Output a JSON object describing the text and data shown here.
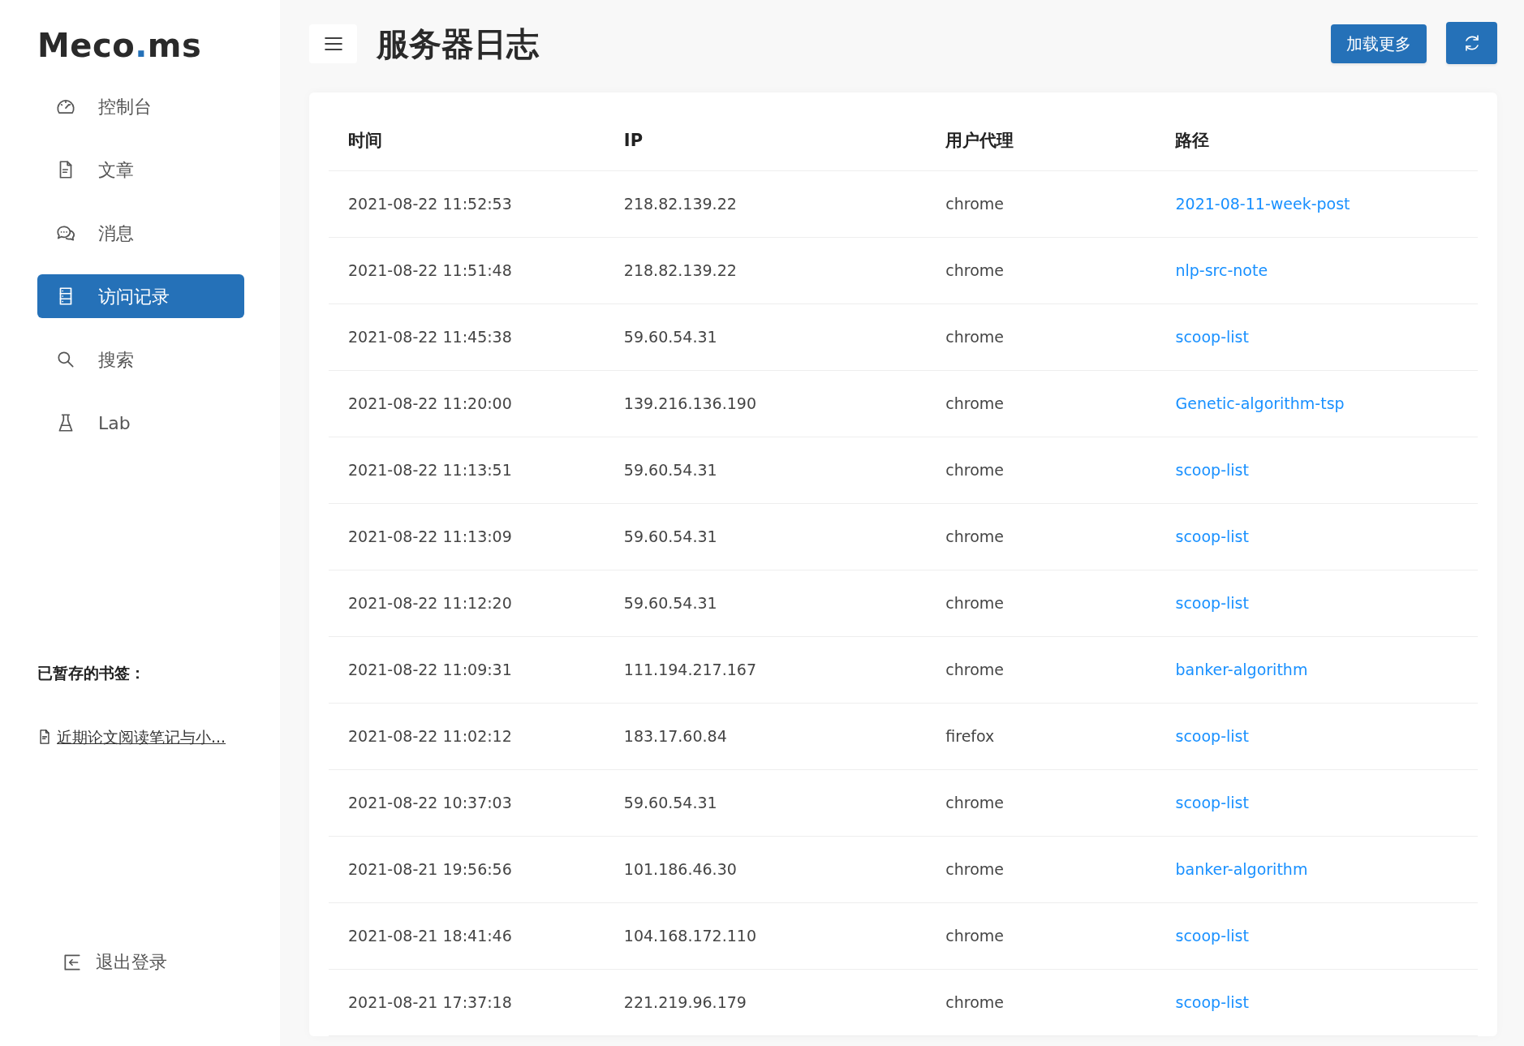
{
  "sidebar": {
    "logo": {
      "name": "Meco",
      "accent": ".",
      "suffix": "ms"
    },
    "items": [
      {
        "label": "控制台",
        "selected": false
      },
      {
        "label": "文章",
        "selected": false
      },
      {
        "label": "消息",
        "selected": false
      },
      {
        "label": "访问记录",
        "selected": true
      },
      {
        "label": "搜索",
        "selected": false
      },
      {
        "label": "Lab",
        "selected": false
      }
    ],
    "bookmarks": {
      "title": "已暂存的书签：",
      "items": [
        {
          "label": "近期论文阅读笔记与小..."
        }
      ]
    },
    "logout": {
      "label": "退出登录"
    }
  },
  "header": {
    "title": "服务器日志",
    "load_more": "加载更多"
  },
  "table": {
    "columns": [
      "时间",
      "IP",
      "用户代理",
      "路径"
    ],
    "rows": [
      {
        "time": "2021-08-22 11:52:53",
        "ip": "218.82.139.22",
        "agent": "chrome",
        "path": "2021-08-11-week-post"
      },
      {
        "time": "2021-08-22 11:51:48",
        "ip": "218.82.139.22",
        "agent": "chrome",
        "path": "nlp-src-note"
      },
      {
        "time": "2021-08-22 11:45:38",
        "ip": "59.60.54.31",
        "agent": "chrome",
        "path": "scoop-list"
      },
      {
        "time": "2021-08-22 11:20:00",
        "ip": "139.216.136.190",
        "agent": "chrome",
        "path": "Genetic-algorithm-tsp"
      },
      {
        "time": "2021-08-22 11:13:51",
        "ip": "59.60.54.31",
        "agent": "chrome",
        "path": "scoop-list"
      },
      {
        "time": "2021-08-22 11:13:09",
        "ip": "59.60.54.31",
        "agent": "chrome",
        "path": "scoop-list"
      },
      {
        "time": "2021-08-22 11:12:20",
        "ip": "59.60.54.31",
        "agent": "chrome",
        "path": "scoop-list"
      },
      {
        "time": "2021-08-22 11:09:31",
        "ip": "111.194.217.167",
        "agent": "chrome",
        "path": "banker-algorithm"
      },
      {
        "time": "2021-08-22 11:02:12",
        "ip": "183.17.60.84",
        "agent": "firefox",
        "path": "scoop-list"
      },
      {
        "time": "2021-08-22 10:37:03",
        "ip": "59.60.54.31",
        "agent": "chrome",
        "path": "scoop-list"
      },
      {
        "time": "2021-08-21 19:56:56",
        "ip": "101.186.46.30",
        "agent": "chrome",
        "path": "banker-algorithm"
      },
      {
        "time": "2021-08-21 18:41:46",
        "ip": "104.168.172.110",
        "agent": "chrome",
        "path": "scoop-list"
      },
      {
        "time": "2021-08-21 17:37:18",
        "ip": "221.219.96.179",
        "agent": "chrome",
        "path": "scoop-list"
      }
    ]
  }
}
